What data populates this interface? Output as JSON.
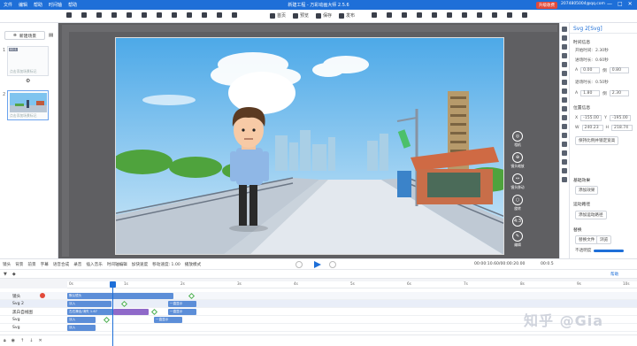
{
  "app": {
    "title": "新建工程 - 万彩动画大师 2.5.6",
    "menu": [
      "文件",
      "编辑",
      "帮助",
      "时间轴",
      "帮助"
    ],
    "vip_label": "升级收费",
    "account_email": "2074805004@qq.com",
    "window_buttons": [
      "—",
      "□",
      "✕"
    ]
  },
  "toolbar": {
    "actions": [
      "首页",
      "预览",
      "保存",
      "发布"
    ]
  },
  "scenes": {
    "new_scene_label": "新建场景",
    "cards": [
      {
        "number": "1",
        "hint": "点击添加场景标记"
      },
      {
        "number": "2",
        "hint": "点击添加场景标记"
      }
    ]
  },
  "stage_tools": [
    "相机",
    "镜头缩放",
    "镜头移动",
    "旋转",
    "4:3",
    "编辑"
  ],
  "properties": {
    "header": "Svg 2[Svg]",
    "timing_title": "时间信息",
    "start_time_label": "开始时间:",
    "start_time": "2.30秒",
    "enter_duration_label": "进场时长:",
    "enter_duration": "0.60秒",
    "exit_duration_label": "退场时长:",
    "exit_duration": "0.50秒",
    "alpha_label": "A",
    "alpha": "0.00",
    "alpha_fix_label": "倒",
    "alpha_fix": "0.80",
    "scale_label": "A",
    "scale": "1.80",
    "scale_fix_label": "倒",
    "scale_fix": "2.30",
    "position_title": "位置信息",
    "x_label": "X",
    "x": "-155.00",
    "y_label": "Y",
    "y": "-195.00",
    "w_label": "W",
    "w": "240.23",
    "h_label": "H",
    "h": "218.74",
    "keep_ratio_button": "保持比例并锁定宽高",
    "effects_title": "基础效果",
    "effects_button": "添加效果",
    "motion_title": "运动路径",
    "motion_button": "添加运动路径",
    "replace_title": "替换",
    "replace_file_button": "替换文件",
    "browse_button": "浏览",
    "opacity_label": "不透明度"
  },
  "timeline": {
    "toolbar_items": [
      "镜头",
      "背景",
      "前景",
      "字幕",
      "语音合成",
      "录音",
      "插入音乐",
      "时间轴编辑",
      "加快速度",
      "移动速度: 1.00",
      "播放模式"
    ],
    "timecode": "00:00:10.60/00:00:20.00",
    "zoom_value": "00:0.5",
    "help_label": "帮助",
    "ruler_ticks": [
      "0s",
      "1s",
      "2s",
      "3s",
      "4s",
      "5s",
      "6s",
      "7s",
      "8s",
      "9s",
      "10s"
    ],
    "tracks": [
      {
        "name": "镜头",
        "bars": [
          "默认镜头"
        ],
        "kind": "camera"
      },
      {
        "name": "Svg 2",
        "bars": [
          "淡入",
          "一直显示"
        ],
        "kind": "svg"
      },
      {
        "name": "黑白自线图",
        "bars": [
          "左右滑出/消失 1.67",
          "一直显示"
        ],
        "kind": "mixed"
      },
      {
        "name": "Svg",
        "bars": [
          "淡入",
          "一直显示"
        ],
        "kind": "svg"
      },
      {
        "name": "Svg",
        "bars": [
          "淡入"
        ],
        "kind": "svg"
      }
    ]
  },
  "watermark": "知乎 @Gia",
  "colors": {
    "brand": "#1e6fd8",
    "vip": "#e24a3a",
    "track_blue": "#5c8ed8",
    "track_purple": "#8f69c9",
    "keyframe": "#4caf50"
  }
}
